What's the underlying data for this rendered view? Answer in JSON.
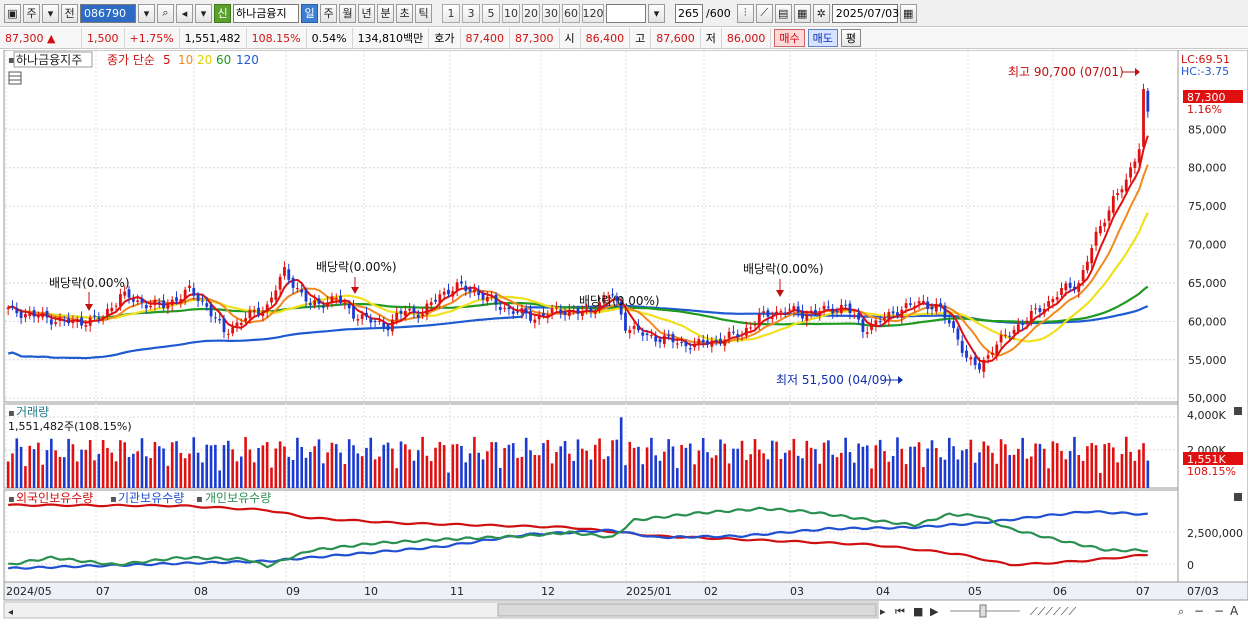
{
  "toolbar": {
    "market": "주",
    "prev": "전",
    "code": "086790",
    "shin": "신",
    "name": "하나금융지",
    "periods": [
      "일",
      "주",
      "월",
      "년",
      "분",
      "초",
      "틱"
    ],
    "active_period": "일",
    "minutes": [
      "1",
      "3",
      "5",
      "10",
      "20",
      "30",
      "60",
      "120"
    ],
    "count": "265",
    "count_total": "/600",
    "date": "2025/07/03"
  },
  "quote": {
    "price": "87,300",
    "arrow": "▲",
    "change": "1,500",
    "change_pct": "+1.75%",
    "volume": "1,551,482",
    "volume_ratio": "108.15%",
    "turnover": "0.54%",
    "amount": "134,810백만",
    "hoga_label": "호가",
    "ask": "87,400",
    "bid": "87,300",
    "open_label": "시",
    "open": "86,400",
    "high_label": "고",
    "high": "87,600",
    "low_label": "저",
    "low": "86,000",
    "buy": "매수",
    "sell": "매도",
    "eval": "평"
  },
  "price_panel": {
    "title": "하나금융지주",
    "ma_label": "종가 단순",
    "ma_periods": [
      "5",
      "10",
      "20",
      "60",
      "120"
    ],
    "lc": "LC:69.51",
    "hc": "HC:-3.75",
    "current_label": "87,300",
    "current_pct": "1.16%",
    "y_ticks": [
      "85,000",
      "80,000",
      "75,000",
      "70,000",
      "65,000",
      "60,000",
      "55,000",
      "50,000"
    ],
    "high_note": "최고 90,700 (07/01)",
    "low_note": "최저 51,500 (04/09)",
    "dividend_notes": [
      "배당락(0.00%)",
      "배당락(0.00%)",
      "배당락(0.00%)",
      "배당락(0.00%)"
    ]
  },
  "volume_panel": {
    "title": "거래량",
    "summary": "1,551,482주(108.15%)",
    "y_ticks": [
      "4,000K",
      "2,000K"
    ],
    "current_label": "1,551K",
    "current_pct": "108.15%"
  },
  "holdings_panel": {
    "titles": [
      "외국인보유수량",
      "기관보유수량",
      "개인보유수량"
    ],
    "y_ticks": [
      "2,500,000",
      "0"
    ]
  },
  "x_axis": {
    "labels": [
      "2024/05",
      "07",
      "08",
      "09",
      "10",
      "11",
      "12",
      "2025/01",
      "02",
      "03",
      "04",
      "05",
      "06",
      "07"
    ],
    "right_label": "07/03"
  },
  "colors": {
    "up": "#e01010",
    "down": "#1a3ad0",
    "ma5": "#e01010",
    "ma10": "#f08a1e",
    "ma20": "#f0e01e",
    "ma60": "#1e9a1e",
    "ma120": "#1e5ad0",
    "foreign": "#d01010",
    "institution": "#2050d0",
    "individual": "#2a9050"
  },
  "chart_data": {
    "type": "line",
    "title": "하나금융지주",
    "ylim": [
      50000,
      92000
    ],
    "series": [
      {
        "name": "종가",
        "x": [
          "2024/05",
          "07",
          "08",
          "09",
          "10",
          "11",
          "12",
          "2025/01",
          "02",
          "03",
          "04",
          "05",
          "06",
          "07"
        ],
        "values": [
          61000,
          62500,
          60500,
          63000,
          59500,
          62000,
          61000,
          57500,
          60500,
          61000,
          53500,
          62500,
          76000,
          87300
        ]
      }
    ],
    "highest": {
      "value": 90700,
      "date": "07/01"
    },
    "lowest": {
      "value": 51500,
      "date": "04/09"
    }
  }
}
